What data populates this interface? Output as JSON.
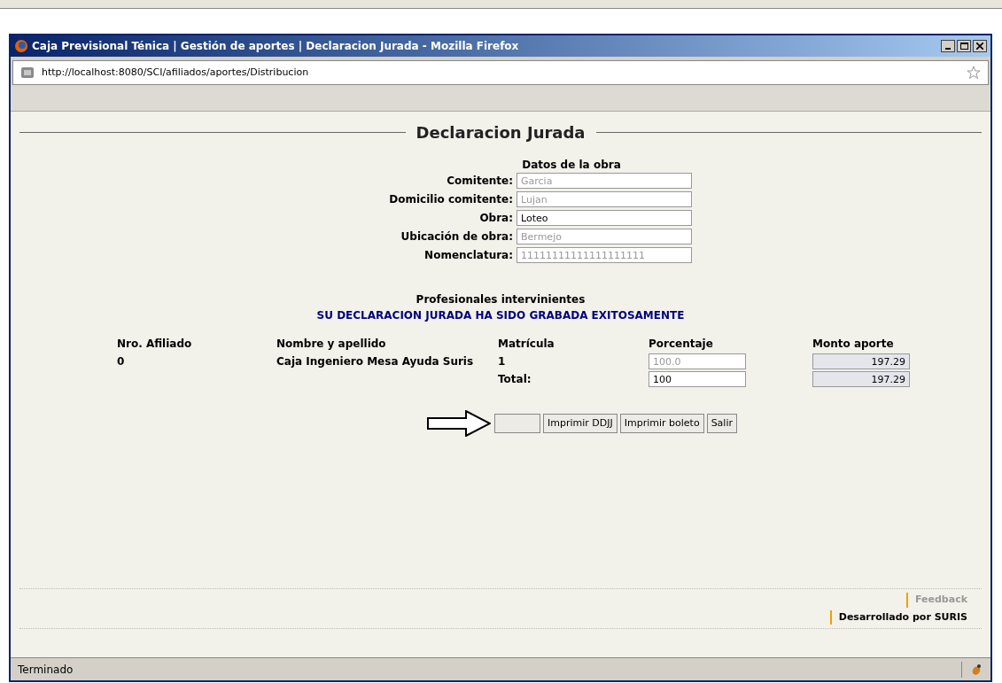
{
  "window": {
    "title": "Caja Previsional Ténica | Gestión de aportes | Declaracion Jurada - Mozilla Firefox",
    "url": "http://localhost:8080/SCI/afiliados/aportes/Distribucion"
  },
  "page": {
    "heading": "Declaracion Jurada",
    "section_title": "Datos de la obra",
    "fields": [
      {
        "label": "Comitente:",
        "value": "Garcia",
        "disabled": true
      },
      {
        "label": "Domicilio comitente:",
        "value": "Lujan",
        "disabled": true
      },
      {
        "label": "Obra:",
        "value": "Loteo",
        "disabled": false
      },
      {
        "label": "Ubicación de obra:",
        "value": "Bermejo",
        "disabled": true
      },
      {
        "label": "Nomenclatura:",
        "value": "11111111111111111111",
        "disabled": true
      }
    ],
    "professionals_title": "Profesionales intervinientes",
    "success_message": "SU DECLARACION JURADA HA SIDO GRABADA EXITOSAMENTE",
    "table": {
      "columns": [
        "Nro. Afiliado",
        "Nombre y apellido",
        "Matrícula",
        "Porcentaje",
        "Monto aporte"
      ],
      "rows": [
        {
          "nro": "0",
          "nombre": "Caja Ingeniero Mesa Ayuda Suris",
          "matricula": "1",
          "porcentaje": "100.0",
          "porcentaje_disabled": true,
          "monto": "197.29"
        }
      ],
      "total": {
        "label": "Total:",
        "porcentaje": "100",
        "porcentaje_disabled": false,
        "monto": "197.29"
      }
    },
    "buttons": [
      {
        "kind": "blank"
      },
      {
        "kind": "text",
        "label": "Imprimir DDJJ"
      },
      {
        "kind": "text",
        "label": "Imprimir boleto"
      },
      {
        "kind": "text",
        "label": "Salir"
      }
    ],
    "footer": {
      "feedback": "Feedback",
      "credit": "Desarrollado por SURIS"
    }
  },
  "status_bar": "Terminado"
}
